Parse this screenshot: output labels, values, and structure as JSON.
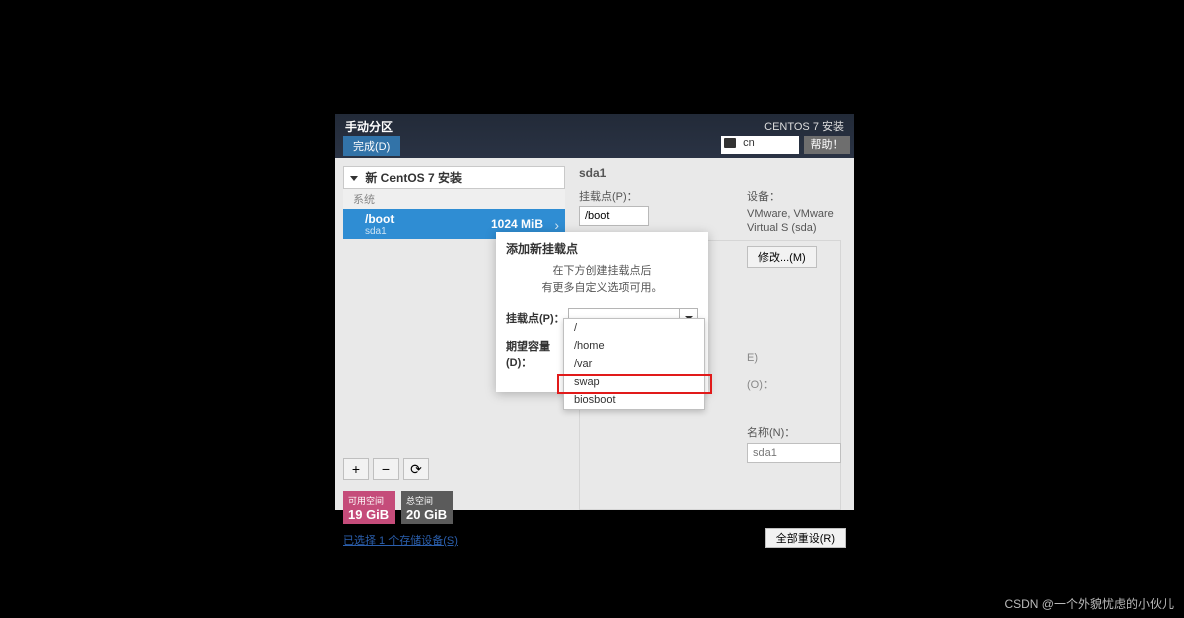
{
  "header": {
    "title": "手动分区",
    "done_label": "完成(D)",
    "product": "CENTOS 7 安装",
    "lang": "cn",
    "help_label": "帮助！"
  },
  "left": {
    "group_title": "新 CentOS 7 安装",
    "subgroup": "系统",
    "mount_path": "/boot",
    "mount_dev": "sda1",
    "mount_size": "1024 MiB",
    "btn_plus": "+",
    "btn_minus": "−",
    "btn_reload": "⟳",
    "free_label": "可用空间",
    "free_value": "19 GiB",
    "total_label": "总空间",
    "total_value": "20 GiB",
    "storage_link": "已选择 1 个存储设备(S)",
    "reset_label": "全部重设(R)"
  },
  "right": {
    "title": "sda1",
    "mount_label": "挂载点(P)：",
    "mount_value": "/boot",
    "dev_label": "设备：",
    "dev_name": "VMware, VMware Virtual S (sda)",
    "modify_label": "修改...(M)",
    "encrypt_hint": "E)",
    "volgroup_hint": "(O)：",
    "name_label": "名称(N)：",
    "name_value": "sda1"
  },
  "dialog": {
    "title": "添加新挂载点",
    "desc1": "在下方创建挂载点后",
    "desc2": "有更多自定义选项可用。",
    "mount_label": "挂载点(P)：",
    "capacity_label": "期望容量(D)：",
    "options": [
      "/",
      "/home",
      "/var",
      "swap",
      "biosboot"
    ]
  },
  "watermark": "CSDN @一个外貌忧虑的小伙儿"
}
